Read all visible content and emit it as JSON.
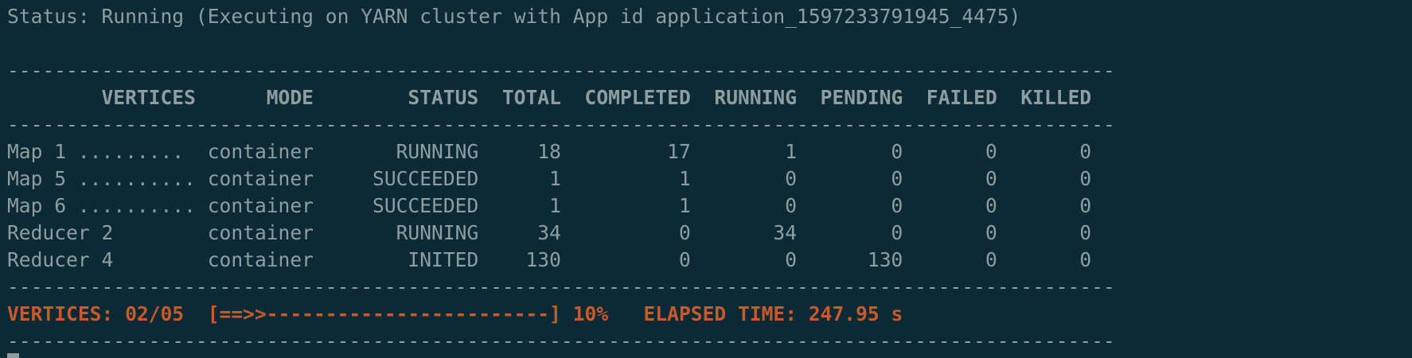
{
  "status_line": "Status: Running (Executing on YARN cluster with App id application_1597233791945_4475)",
  "separator": "----------------------------------------------------------------------------------------------",
  "header": "        VERTICES      MODE        STATUS  TOTAL  COMPLETED  RUNNING  PENDING  FAILED  KILLED",
  "rows": [
    "Map 1 .........  container       RUNNING     18         17        1        0       0       0",
    "Map 5 .......... container     SUCCEEDED      1          1        0        0       0       0",
    "Map 6 .......... container     SUCCEEDED      1          1        0        0       0       0",
    "Reducer 2        container       RUNNING     34          0       34        0       0       0",
    "Reducer 4        container        INITED    130          0        0      130       0       0"
  ],
  "summary": "VERTICES: 02/05  [==>>------------------------] 10%   ELAPSED TIME: 247.95 s",
  "colors": {
    "background": "#0c2a35",
    "text": "#8e9ea0",
    "accent": "#c75a2a"
  }
}
